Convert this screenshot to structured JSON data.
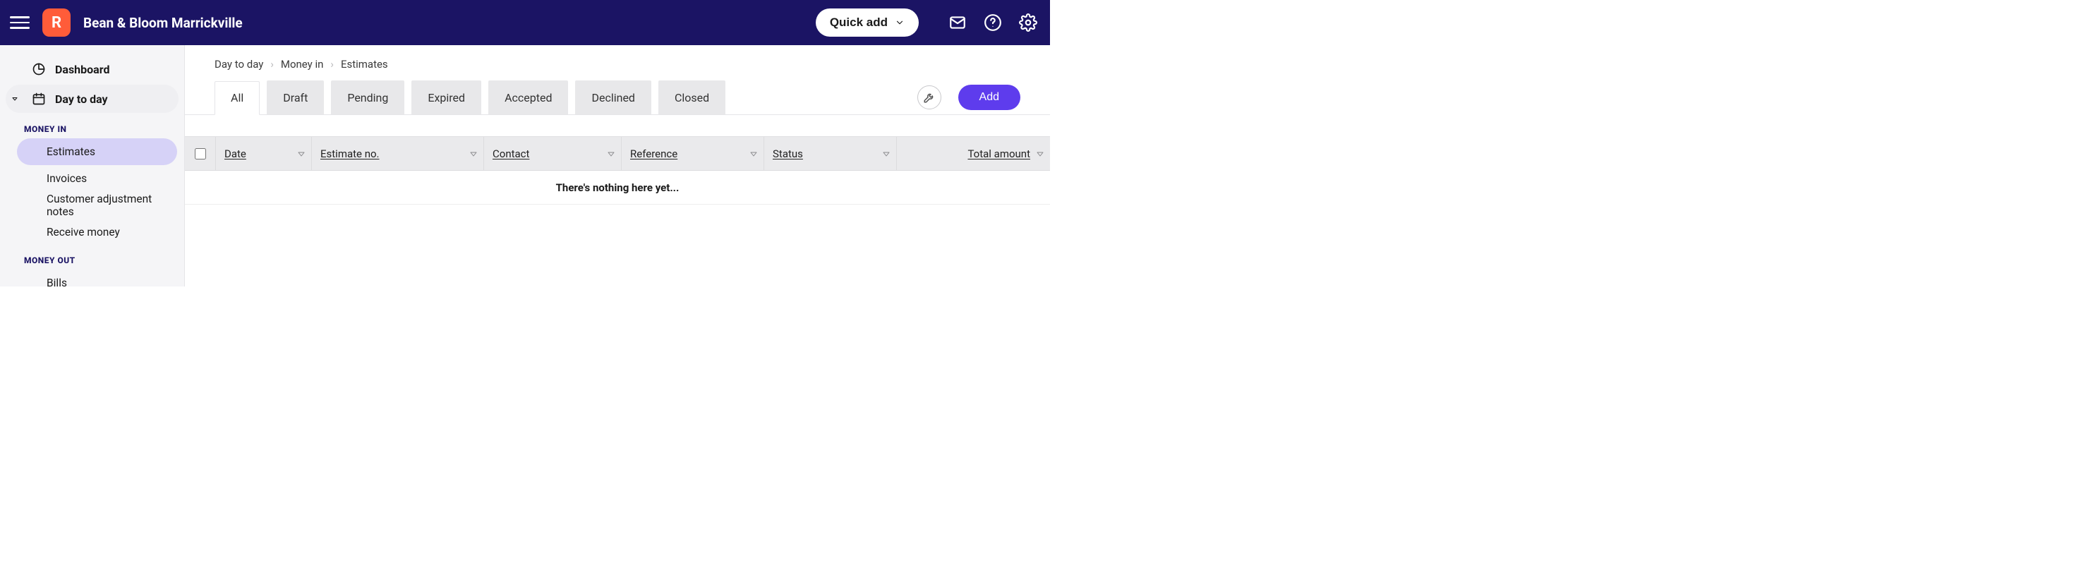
{
  "header": {
    "org_name": "Bean & Bloom Marrickville",
    "logo_letter": "R",
    "quick_add_label": "Quick add"
  },
  "sidebar": {
    "dashboard_label": "Dashboard",
    "day_to_day_label": "Day to day",
    "section_money_in": "MONEY IN",
    "money_in_items": [
      {
        "label": "Estimates",
        "active": true
      },
      {
        "label": "Invoices",
        "active": false
      },
      {
        "label": "Customer adjustment notes",
        "active": false
      },
      {
        "label": "Receive money",
        "active": false
      }
    ],
    "section_money_out": "MONEY OUT",
    "money_out_items": [
      {
        "label": "Bills",
        "active": false
      }
    ]
  },
  "breadcrumb": {
    "items": [
      "Day to day",
      "Money in",
      "Estimates"
    ]
  },
  "tabs": {
    "items": [
      {
        "label": "All",
        "active": true
      },
      {
        "label": "Draft",
        "active": false
      },
      {
        "label": "Pending",
        "active": false
      },
      {
        "label": "Expired",
        "active": false
      },
      {
        "label": "Accepted",
        "active": false
      },
      {
        "label": "Declined",
        "active": false
      },
      {
        "label": "Closed",
        "active": false
      }
    ],
    "add_label": "Add"
  },
  "table": {
    "columns": {
      "date": "Date",
      "estimate_no": "Estimate no.",
      "contact": "Contact",
      "reference": "Reference",
      "status": "Status",
      "total_amount": "Total amount"
    },
    "empty_message": "There's nothing here yet..."
  },
  "colors": {
    "topbar_bg": "#1b1464",
    "logo_bg": "#ff5c39",
    "accent": "#5e3ced",
    "sub_active_bg": "#d6d2f7"
  }
}
